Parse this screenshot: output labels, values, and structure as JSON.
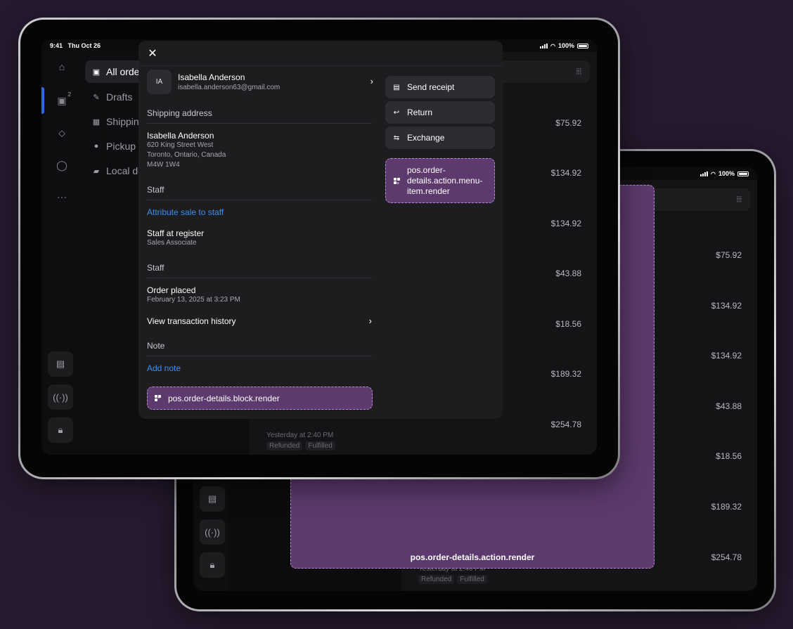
{
  "status_bar": {
    "time": "9:41",
    "date": "Thu Oct 26",
    "battery": "100%"
  },
  "nav": {
    "items": [
      {
        "label": "All orders",
        "icon": "inbox-icon"
      },
      {
        "label": "Drafts",
        "icon": "draft-icon"
      },
      {
        "label": "Shipping",
        "icon": "shipping-icon"
      },
      {
        "label": "Pickup",
        "icon": "pin-icon"
      },
      {
        "label": "Local delivery",
        "icon": "truck-icon"
      }
    ],
    "orders_badge": "2"
  },
  "orders_back": {
    "prices": [
      "$75.92",
      "$134.92",
      "$134.92",
      "$43.88",
      "$18.56",
      "$189.32",
      "$254.78"
    ],
    "last_meta": "Yesterday at 2:40 PM",
    "tags": [
      "Refunded",
      "Fulfilled"
    ]
  },
  "back_device": {
    "extension_label": "pos.order-details.action.render"
  },
  "modal": {
    "close_icon": "close-icon",
    "customer": {
      "initials": "IA",
      "name": "Isabella Anderson",
      "email": "isabella.anderson63@gmail.com"
    },
    "shipping": {
      "title": "Shipping address",
      "name": "Isabella Anderson",
      "line1": "620 King Street West",
      "line2": "Toronto, Ontario, Canada",
      "line3": "M4W 1W4"
    },
    "staff": {
      "title": "Staff",
      "attribute_link": "Attribute sale to staff",
      "register_label": "Staff at register",
      "register_role": "Sales Associate",
      "title2": "Staff"
    },
    "order": {
      "placed_label": "Order placed",
      "placed_date": "February 13, 2025 at 3:23 PM",
      "history_link": "View transaction history"
    },
    "note": {
      "title": "Note",
      "add_link": "Add note"
    },
    "block_extension": "pos.order-details.block.render",
    "actions": {
      "send_receipt": "Send receipt",
      "return": "Return",
      "exchange": "Exchange",
      "menu_item_extension": "pos.order-details.action.menu-item.render"
    }
  }
}
